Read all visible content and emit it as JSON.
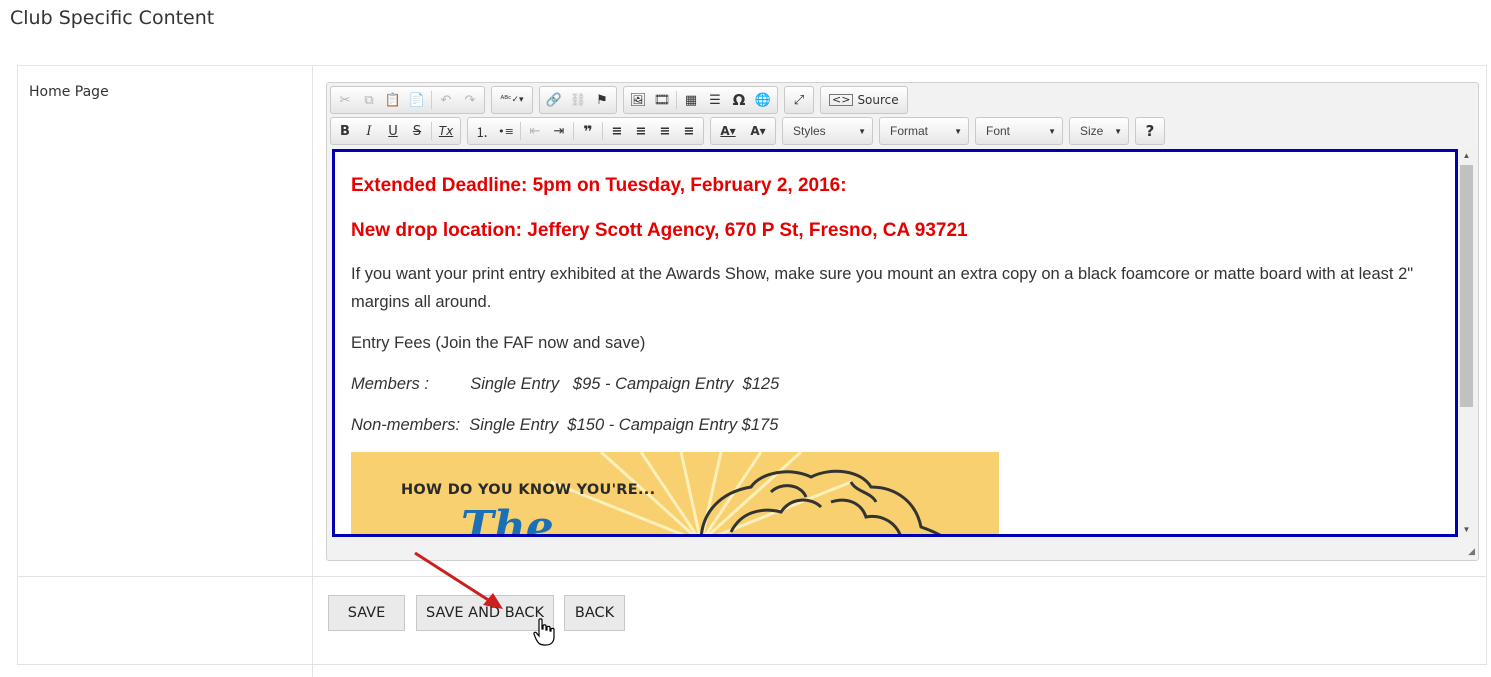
{
  "page": {
    "title": "Club Specific Content"
  },
  "form": {
    "field_label": "Home Page"
  },
  "toolbar": {
    "row1": [
      [
        "cut-icon",
        "✂",
        true
      ],
      [
        "copy-icon",
        "⧉",
        true
      ],
      [
        "paste-icon",
        "📋",
        false
      ],
      [
        "paste-text-icon",
        "📄",
        false
      ],
      [
        "undo-icon",
        "↶",
        true
      ],
      [
        "redo-icon",
        "↷",
        true
      ],
      [
        "spellcheck-icon",
        "ᴬᴮᶜ✓▾",
        false
      ],
      [
        "link-icon",
        "🔗",
        false
      ],
      [
        "unlink-icon",
        "⛓",
        true
      ],
      [
        "anchor-icon",
        "⚑",
        false
      ],
      [
        "image-icon",
        "🖼",
        false
      ],
      [
        "flash-icon",
        "🎞",
        false
      ],
      [
        "table-icon",
        "▦",
        false
      ],
      [
        "horizontal-line-icon",
        "☰",
        false
      ],
      [
        "special-char-icon",
        "Ω",
        false
      ],
      [
        "iframe-icon",
        "🌐",
        false
      ],
      [
        "maximize-icon",
        "⤢",
        false
      ]
    ],
    "source_label": "Source",
    "row2_format": [
      [
        "bold-icon",
        "B"
      ],
      [
        "italic-icon",
        "I"
      ],
      [
        "underline-icon",
        "U"
      ],
      [
        "strike-icon",
        "S"
      ],
      [
        "remove-format-icon",
        "Tx"
      ]
    ],
    "row2_list": [
      [
        "numbered-list-icon",
        "⒈"
      ],
      [
        "bulleted-list-icon",
        "•≡"
      ],
      [
        "outdent-icon",
        "⇤",
        true
      ],
      [
        "indent-icon",
        "⇥"
      ],
      [
        "blockquote-icon",
        "❞"
      ],
      [
        "align-left-icon",
        "≡"
      ],
      [
        "align-center-icon",
        "≡"
      ],
      [
        "align-right-icon",
        "≡"
      ],
      [
        "justify-icon",
        "≡"
      ]
    ],
    "text_color_icon": "A▾",
    "bg_color_icon": "A▾",
    "styles_label": "Styles",
    "format_label": "Format",
    "font_label": "Font",
    "size_label": "Size",
    "help_icon": "?"
  },
  "content": {
    "heading1": "Extended Deadline: 5pm on Tuesday, February 2, 2016:",
    "heading2": "New drop location: Jeffery Scott Agency, 670 P St, Fresno, CA 93721",
    "para1": "If you want your print entry exhibited at the Awards Show, make sure you mount an extra copy on a black foamcore or matte board with at least 2\" margins all around.",
    "para2": "Entry Fees (Join the FAF now and save)",
    "members": "Members :         Single Entry   $95 - Campaign Entry  $125",
    "nonmembers": "Non-members:  Single Entry  $150 - Campaign Entry $175",
    "promo_text": "HOW DO YOU KNOW YOU'RE...",
    "promo_partial": "The"
  },
  "buttons": {
    "save": "SAVE",
    "save_and_back": "SAVE AND BACK",
    "back": "BACK"
  },
  "colors": {
    "editor_border": "#0000b3",
    "heading_red": "#e60000",
    "promo_bg": "#f8d070",
    "arrow_red": "#cc1f1f"
  }
}
